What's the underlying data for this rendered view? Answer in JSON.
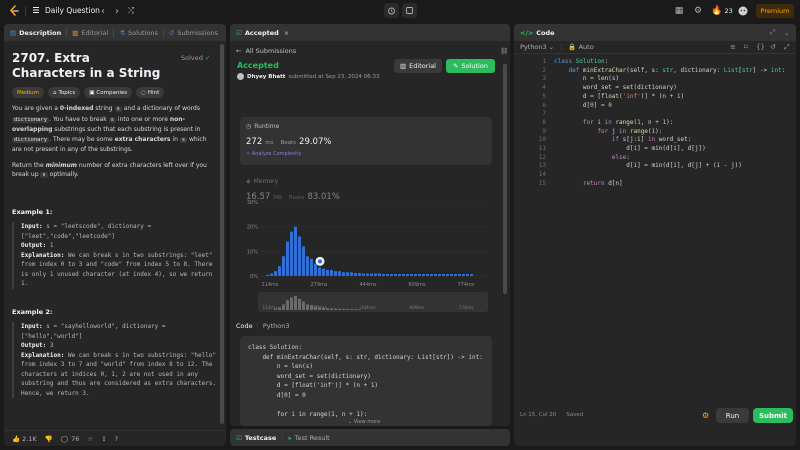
{
  "topbar": {
    "nav_title": "Daily Question",
    "streak_count": "23",
    "premium_label": "Premium"
  },
  "description": {
    "tabs": [
      {
        "label": "Description"
      },
      {
        "label": "Editorial"
      },
      {
        "label": "Solutions"
      },
      {
        "label": "Submissions"
      }
    ],
    "title": "2707. Extra Characters in a String",
    "solved_label": "Solved",
    "tags": [
      "Medium",
      "Topics",
      "Companies",
      "Hint"
    ],
    "para1_a": "You are given a ",
    "para1_b": "0-indexed",
    "para1_c": " string ",
    "para1_s": "s",
    "para1_d": " and a dictionary of words ",
    "para1_dict": "dictionary",
    "para1_e": ". You have to break ",
    "para1_s2": "s",
    "para1_f": " into one or more ",
    "para1_g": "non-overlapping",
    "para1_h": " substrings such that each substring is present in ",
    "para1_dict2": "dictionary",
    "para1_i": ". There may be some ",
    "para1_j": "extra characters",
    "para1_k": " in ",
    "para1_s3": "s",
    "para1_l": " which are not present in any of the substrings.",
    "para2_a": "Return the ",
    "para2_b": "minimum",
    "para2_c": " number of extra characters left over if you break up ",
    "para2_s": "s",
    "para2_d": " optimally.",
    "ex1_title": "Example 1:",
    "ex1_input_label": "Input:",
    "ex1_input": " s = \"leetscode\", dictionary = [\"leet\",\"code\",\"leetcode\"]",
    "ex1_output_label": "Output:",
    "ex1_output": " 1",
    "ex1_expl_label": "Explanation:",
    "ex1_expl": " We can break s in two substrings: \"leet\" from index 0 to 3 and \"code\" from index 5 to 8. There is only 1 unused character (at index 4), so we return 1.",
    "ex2_title": "Example 2:",
    "ex2_input_label": "Input:",
    "ex2_input": " s = \"sayhelloworld\", dictionary = [\"hello\",\"world\"]",
    "ex2_output_label": "Output:",
    "ex2_output": " 3",
    "ex2_expl_label": "Explanation:",
    "ex2_expl": " We can break s in two substrings: \"hello\" from index 3 to 7 and \"world\" from index 8 to 12. The characters at indices 0, 1, 2 are not used in any substring and thus are considered as extra characters. Hence, we return 3.",
    "likes": "2.1K",
    "comments": "76"
  },
  "submission": {
    "tab_label": "Accepted",
    "back_label": "All Submissions",
    "status": "Accepted",
    "submitter": "Dhyey Bhatt",
    "submitted_text": "submitted at Sep 23, 2024 06:33",
    "editorial_label": "Editorial",
    "solution_label": "Solution",
    "runtime_label": "Runtime",
    "runtime_value": "272",
    "runtime_unit": "ms",
    "beats_label": "Beats",
    "runtime_beats": "29.07%",
    "analyze_label": "Analyze Complexity",
    "memory_label": "Memory",
    "memory_value": "16.57",
    "memory_unit": "MB",
    "memory_beats": "83.01%",
    "code_tab": "Code",
    "code_lang": "Python3",
    "view_more": "View more",
    "code_lines": [
      "class Solution:",
      "    def minExtraChar(self, s: str, dictionary: List[str]) -> int:",
      "        n = len(s)",
      "        word_set = set(dictionary)",
      "        d = [float('inf')] * (n + 1)",
      "        d[0] = 0",
      "",
      "        for i in range(1, n + 1):"
    ]
  },
  "chart_data": {
    "type": "bar",
    "x_tick_labels": [
      "114ms",
      "279ms",
      "444ms",
      "609ms",
      "774ms"
    ],
    "y_tick_labels": [
      "0%",
      "10%",
      "20%",
      "30%"
    ],
    "ylim": [
      0,
      30
    ],
    "values": [
      0.5,
      1,
      2,
      4,
      8,
      14,
      18,
      20,
      16,
      12,
      8,
      7,
      5,
      3.5,
      3,
      2.5,
      2.5,
      2,
      2,
      1.5,
      1.5,
      1.5,
      1.2,
      1.2,
      1,
      1,
      1,
      1,
      1,
      0.8,
      0.8,
      0.8,
      0.8,
      0.8,
      0.8,
      0.8,
      0.8,
      0.8,
      0.8,
      0.8,
      0.8,
      0.8,
      0.8,
      0.8,
      0.8,
      0.8,
      0.8,
      0.8,
      0.8,
      0.8,
      0.8,
      0.8
    ],
    "highlight_index": 13,
    "bar_color": "#2f6fd6",
    "overview_x_tick_labels": [
      "114ms",
      "279ms",
      "444ms",
      "609ms",
      "774ms"
    ]
  },
  "testcase": {
    "testcase_label": "Testcase",
    "result_label": "Test Result"
  },
  "editor": {
    "panel_label": "Code",
    "language": "Python3",
    "mode": "Auto",
    "line_numbers": [
      "1",
      "2",
      "3",
      "4",
      "5",
      "6",
      "7",
      "8",
      "9",
      "10",
      "11",
      "12",
      "13",
      "14",
      "15"
    ],
    "status_position": "Ln 15, Col 20",
    "status_saved": "Saved",
    "run_label": "Run",
    "submit_label": "Submit"
  }
}
